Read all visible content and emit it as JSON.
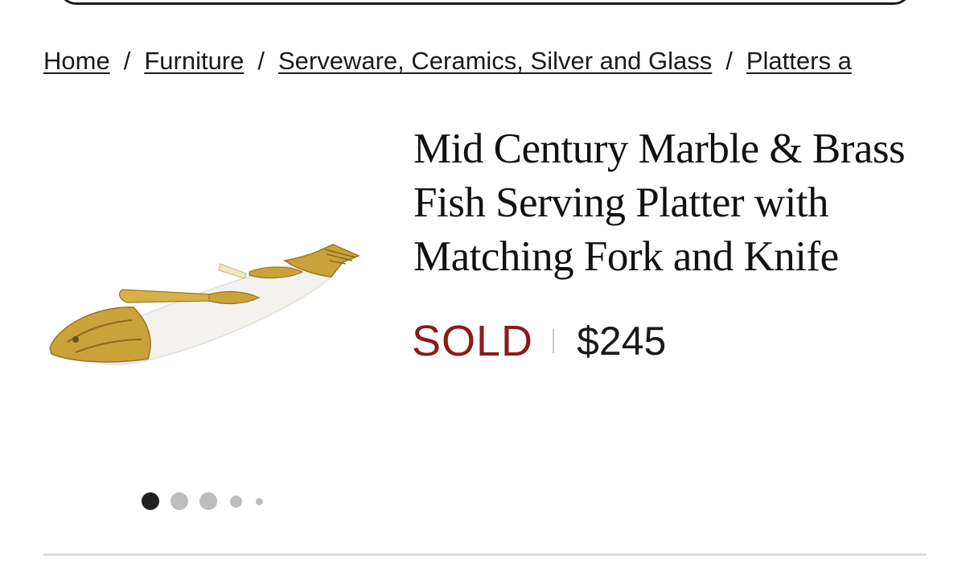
{
  "breadcrumb": {
    "items": [
      {
        "label": "Home"
      },
      {
        "label": "Furniture"
      },
      {
        "label": "Serveware, Ceramics, Silver and Glass"
      },
      {
        "label": "Platters a"
      }
    ],
    "separator": "/"
  },
  "product": {
    "title": "Mid Century Marble & Brass Fish Serving Platter with Matching Fork and Knife",
    "status": "SOLD",
    "price": "$245",
    "image_alt": "Marble fish platter with brass head, tail, fork and knife"
  },
  "gallery": {
    "image_count": 5,
    "active_index": 0
  },
  "colors": {
    "sold_red": "#8b1a1a",
    "active_dot": "#1f1f1f",
    "inactive_dot": "#bdbdbd",
    "brass": "#c9a23a",
    "marble": "#f4f2ee"
  }
}
